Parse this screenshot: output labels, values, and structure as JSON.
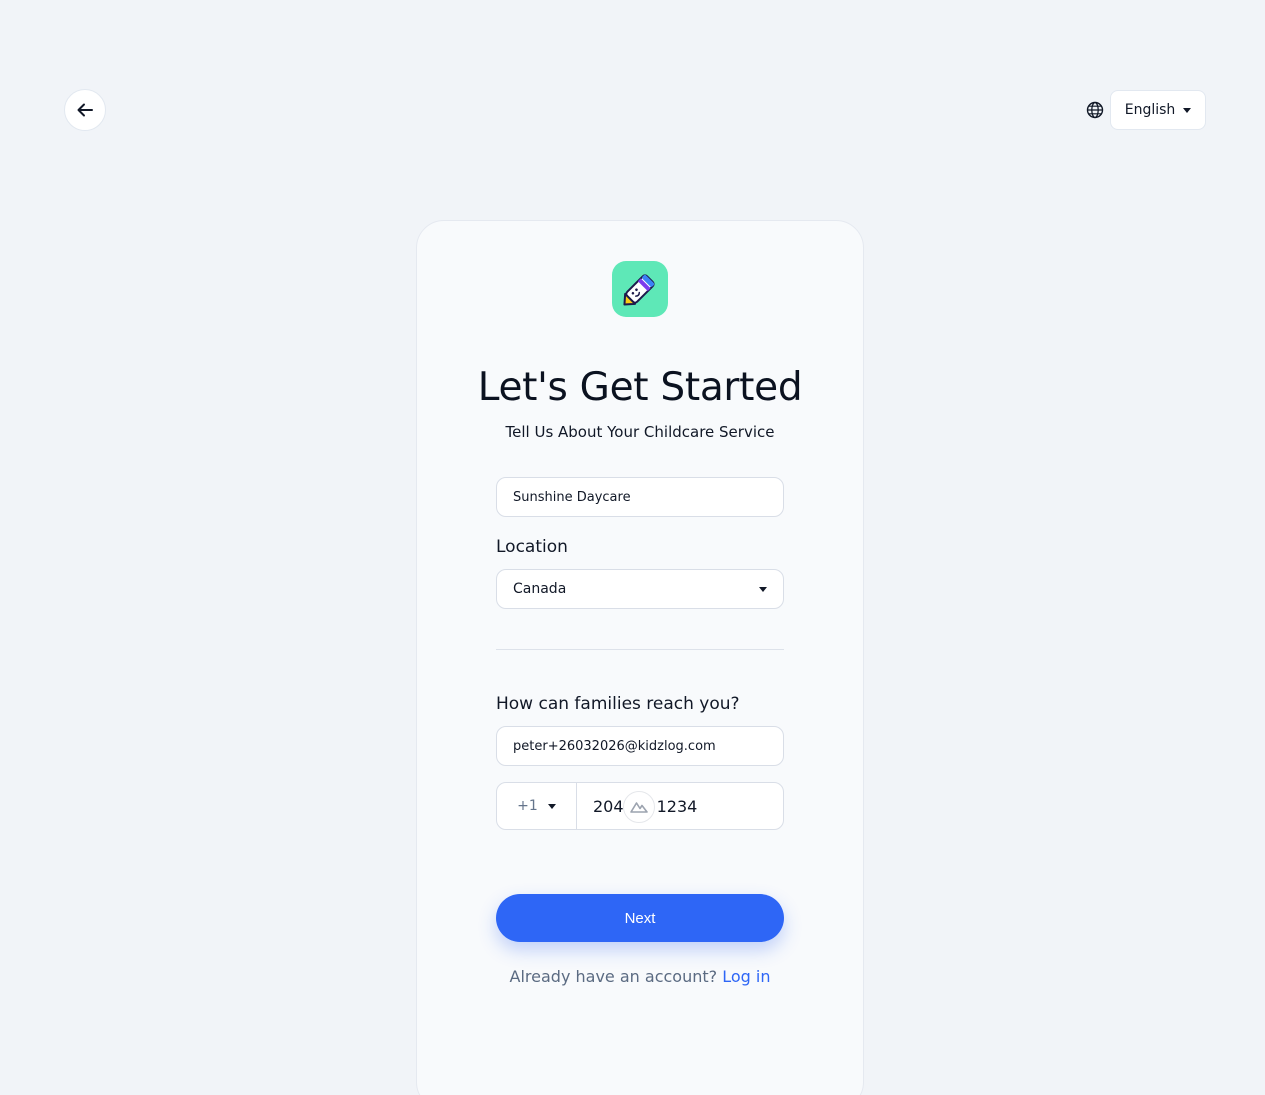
{
  "header": {
    "back_icon": "arrow-left-icon",
    "globe_icon": "globe-icon",
    "language": "English"
  },
  "card": {
    "logo_icon": "pencil-mascot-icon",
    "title": "Let's Get Started",
    "subtitle": "Tell Us About Your Childcare Service",
    "business_name": {
      "value": "Sunshine Daycare"
    },
    "location": {
      "label": "Location",
      "selected": "Canada"
    },
    "contact": {
      "label": "How can families reach you?",
      "email": "peter+26032026@kidzlog.com",
      "country_code": "+1",
      "phone": "204 1234"
    },
    "next_label": "Next",
    "login_prompt": "Already have an account?",
    "login_link": "Log in"
  },
  "colors": {
    "accent": "#2e66f6",
    "logo_bg": "#5ee8b7",
    "background": "#f1f4f8"
  }
}
